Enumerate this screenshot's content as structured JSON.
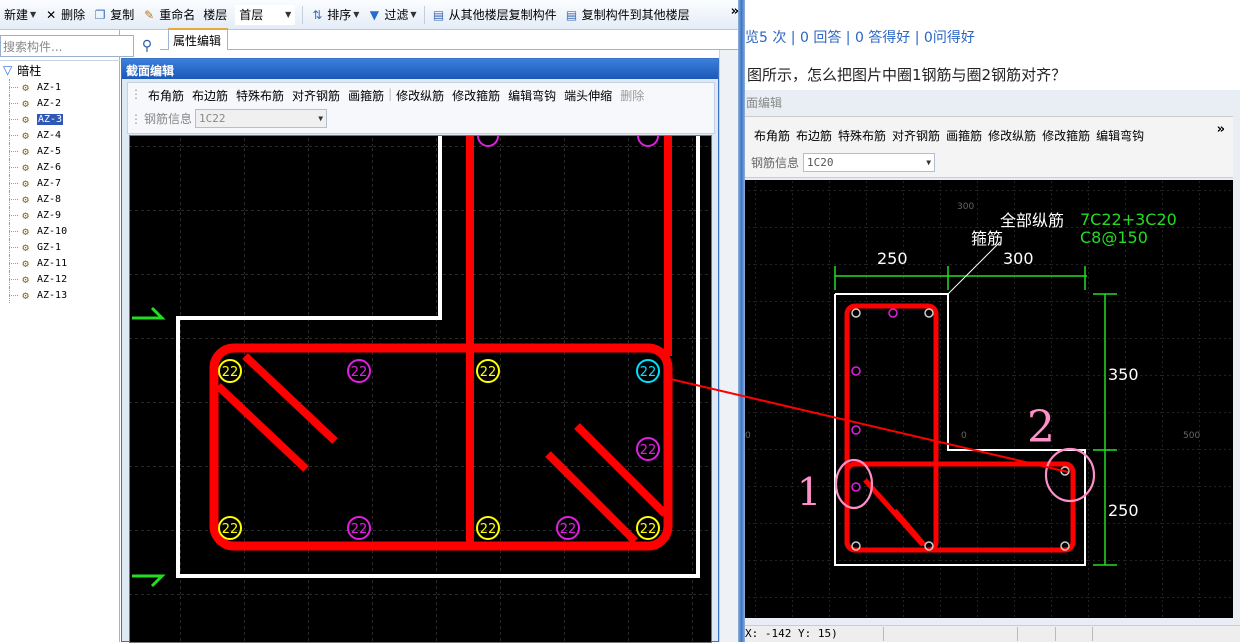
{
  "toolbar": {
    "new": "新建",
    "delete": "删除",
    "copy": "复制",
    "rename": "重命名",
    "floor_label": "楼层",
    "floor_value": "首层",
    "sort": "排序",
    "filter": "过滤",
    "copy_from_floor": "从其他楼层复制构件",
    "copy_to_floor": "复制构件到其他楼层",
    "more": "»"
  },
  "search": {
    "placeholder": "搜索构件..."
  },
  "tree": {
    "root": "暗柱",
    "items": [
      "AZ-1",
      "AZ-2",
      "AZ-3",
      "AZ-4",
      "AZ-5",
      "AZ-6",
      "AZ-7",
      "AZ-8",
      "AZ-9",
      "AZ-10",
      "GZ-1",
      "AZ-11",
      "AZ-12",
      "AZ-13"
    ],
    "selected": "AZ-3"
  },
  "prop_tab": {
    "label": "属性编辑"
  },
  "section_window": {
    "title": "截面编辑",
    "tools": [
      "布角筋",
      "布边筋",
      "特殊布筋",
      "对齐钢筋",
      "画箍筋",
      "修改纵筋",
      "修改箍筋",
      "编辑弯钩",
      "端头伸缩"
    ],
    "tool_disabled": "删除",
    "rebar_info_label": "钢筋信息",
    "rebar_info_value": "1C22",
    "bar_label": "22"
  },
  "right_pane": {
    "stats": "览5 次 | 0 回答 | 0 答得好 | 0问得好",
    "question": "图所示，怎么把图片中圈1钢筋与圈2钢筋对齐？",
    "inner_title": "面编辑",
    "tools": [
      "布角筋",
      "布边筋",
      "特殊布筋",
      "对齐钢筋",
      "画箍筋",
      "修改纵筋",
      "修改箍筋",
      "编辑弯钩"
    ],
    "more": "»",
    "rebar_info_label": "钢筋信息",
    "rebar_info_value": "1C20",
    "annotations": {
      "all_long_bars_label": "全部纵筋",
      "all_long_bars_value": "7C22+3C20",
      "stirrup_label": "箍筋",
      "stirrup_value": "C8@150",
      "dim_top_1": "250",
      "dim_top_2": "300",
      "dim_right_1": "350",
      "dim_right_2": "250",
      "axis_300": "300",
      "axis_0": "0",
      "axis_500": "500",
      "axis_left": "0"
    },
    "handwritten_1": "1",
    "handwritten_2": "2",
    "status": "X: -142 Y: 15)"
  },
  "colors": {
    "rebar_red": "#ff0000",
    "dim_green": "#22dd22",
    "stirrup_white": "#ffffff",
    "bar_yellow": "#ffff00",
    "bar_magenta": "#e020e0",
    "bar_cyan": "#00e0ff",
    "annotation_pink": "#ff8fc8"
  },
  "icons": [
    "delete-x-icon",
    "copy-icon",
    "rename-icon",
    "sort-icon",
    "filter-funnel-icon",
    "floor-copy-icon",
    "search-magnifier-icon",
    "gear-icon",
    "tree-root-icon"
  ]
}
